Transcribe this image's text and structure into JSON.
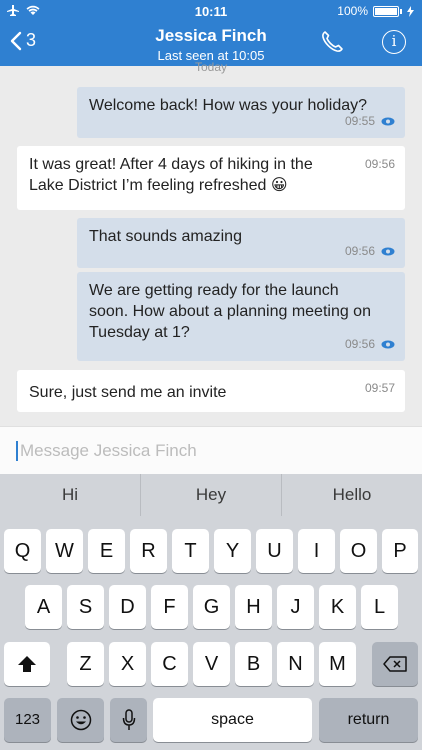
{
  "status": {
    "time": "10:11",
    "battery": "100%"
  },
  "nav": {
    "back_count": "3",
    "contact_name": "Jessica Finch",
    "last_seen": "Last seen at 10:05"
  },
  "chat": {
    "date_separator": "Today",
    "messages": [
      {
        "dir": "out",
        "text": "Welcome back! How was your holiday?",
        "time": "09:55"
      },
      {
        "dir": "in",
        "text": "It was great! After 4 days of hiking in the Lake District I’m feeling refreshed 😀",
        "time": "09:56"
      },
      {
        "dir": "out",
        "text": "That sounds amazing",
        "time": "09:56"
      },
      {
        "dir": "out",
        "text": "We are getting ready for the launch soon. How about a planning meeting on Tuesday at 1?",
        "time": "09:56"
      },
      {
        "dir": "in",
        "text": "Sure, just send me an invite",
        "time": "09:57"
      }
    ]
  },
  "composer": {
    "placeholder": "Message Jessica Finch",
    "value": ""
  },
  "keyboard": {
    "suggestions": [
      "Hi",
      "Hey",
      "Hello"
    ],
    "row1": [
      "Q",
      "W",
      "E",
      "R",
      "T",
      "Y",
      "U",
      "I",
      "O",
      "P"
    ],
    "row2": [
      "A",
      "S",
      "D",
      "F",
      "G",
      "H",
      "J",
      "K",
      "L"
    ],
    "row3": [
      "Z",
      "X",
      "C",
      "V",
      "B",
      "N",
      "M"
    ],
    "numbers_label": "123",
    "space_label": "space",
    "return_label": "return"
  },
  "colors": {
    "accent": "#2f80d1",
    "outgoing_bubble": "#d4deea",
    "incoming_bubble": "#ffffff"
  }
}
